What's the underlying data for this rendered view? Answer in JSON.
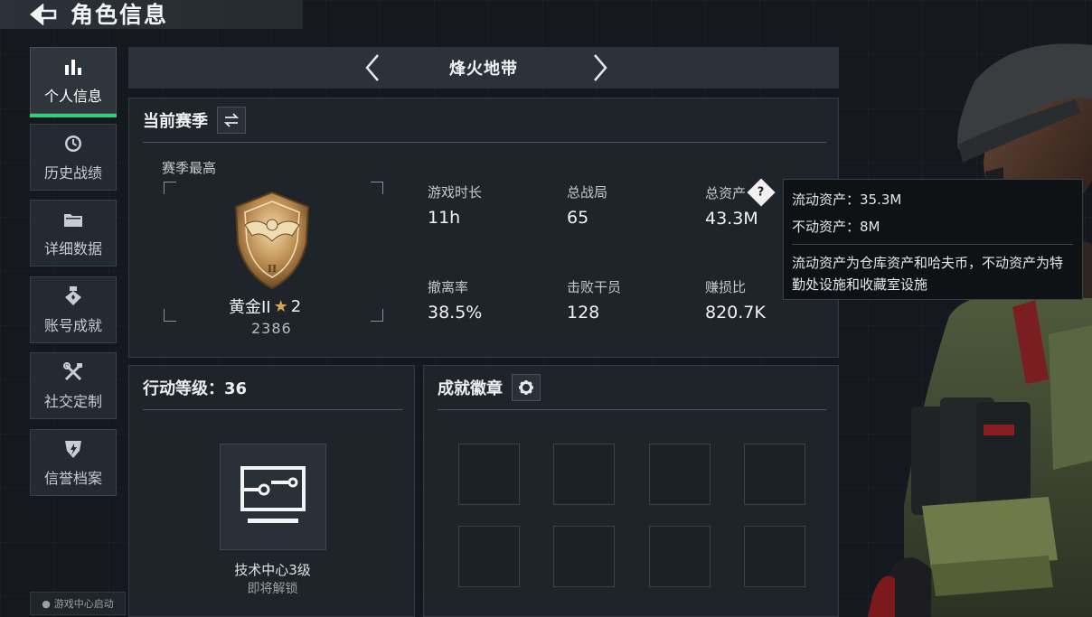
{
  "header": {
    "title": "角色信息"
  },
  "sidebar": {
    "items": [
      {
        "label": "个人信息",
        "icon": "bar-chart-icon",
        "active": true
      },
      {
        "label": "历史战绩",
        "icon": "clock-icon",
        "active": false
      },
      {
        "label": "详细数据",
        "icon": "folder-icon",
        "active": false
      },
      {
        "label": "账号成就",
        "icon": "achievement-icon",
        "active": false
      },
      {
        "label": "社交定制",
        "icon": "tools-icon",
        "active": false
      },
      {
        "label": "信誉档案",
        "icon": "shield-icon",
        "active": false
      }
    ],
    "launch_label": "游戏中心启动"
  },
  "mode": {
    "title": "烽火地带"
  },
  "season": {
    "title": "当前赛季",
    "best_label": "赛季最高",
    "rank": {
      "name": "黄金II",
      "stars": "2",
      "score": "2386"
    },
    "stats": [
      {
        "label": "游戏时长",
        "value": "11h"
      },
      {
        "label": "总战局",
        "value": "65"
      },
      {
        "label": "总资产",
        "value": "43.3M"
      },
      {
        "label": "撤离率",
        "value": "38.5%"
      },
      {
        "label": "击败干员",
        "value": "128"
      },
      {
        "label": "赚损比",
        "value": "820.7K"
      }
    ]
  },
  "tooltip": {
    "liquid": "流动资产：35.3M",
    "fixed": "不动资产：8M",
    "desc": "流动资产为仓库资产和哈夫币，不动资产为特勤处设施和收藏室设施"
  },
  "level": {
    "title": "行动等级：36",
    "card_name": "技术中心3级",
    "card_status": "即将解锁"
  },
  "badges": {
    "title": "成就徽章",
    "slot_count": 8
  },
  "colors": {
    "accent": "#2fd07a",
    "gold": "#d7a84a",
    "panel": "#1f242a"
  }
}
